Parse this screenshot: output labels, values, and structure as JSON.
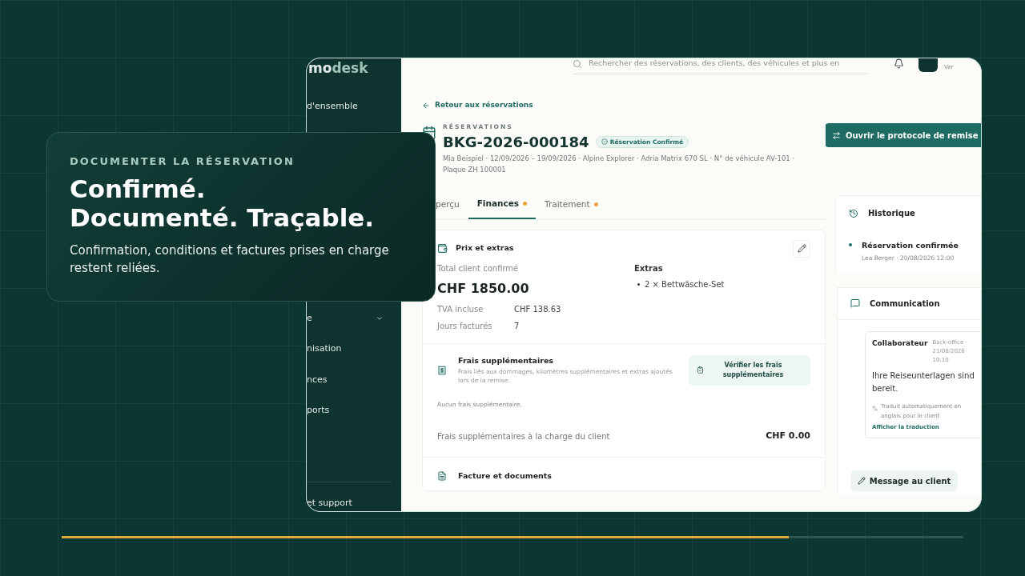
{
  "app": {
    "logo": {
      "part_1": "mo",
      "part_2": "desk"
    },
    "sidebar": {
      "items": [
        {
          "label": "d'ensemble",
          "kind": "link"
        },
        {
          "label": "e",
          "kind": "group"
        },
        {
          "label": "nisation",
          "kind": "link"
        },
        {
          "label": "nces",
          "kind": "link"
        },
        {
          "label": "ports",
          "kind": "link"
        }
      ],
      "footer": "et support"
    },
    "topbar": {
      "search_placeholder": "Rechercher des réservations, des clients, des véhicules et plus en",
      "user": "Ver"
    },
    "back_link": "Retour aux réservations",
    "header": {
      "eyebrow": "RÉSERVATIONS",
      "title": "BKG-2026-000184",
      "status": "Réservation Confirmé",
      "meta": "Mia Beispiel · 12/09/2026 – 19/09/2026 · Alpine Explorer · Adria Matrix 670 SL · N° de véhicule AV-101 · Plaque ZH 100001",
      "action": "Ouvrir le protocole de remise"
    },
    "tabs": [
      {
        "label": "perçu",
        "selected": false,
        "badge": false
      },
      {
        "label": "Finances",
        "selected": true,
        "badge": true
      },
      {
        "label": "Traitement",
        "selected": false,
        "badge": true
      }
    ],
    "price": {
      "title": "Prix et extras",
      "total_label": "Total client confirmé",
      "total": "CHF 1850.00",
      "rows": [
        {
          "label": "TVA incluse",
          "value": "CHF 138.63"
        },
        {
          "label": "Jours facturés",
          "value": "7"
        }
      ],
      "extras_title": "Extras",
      "extras": [
        "2 × Bettwäsche-Set"
      ]
    },
    "fees": {
      "title": "Frais supplémentaires",
      "description": "Frais liés aux dommages, kilomètres supplémentaires et extras ajoutés lors de la remise.",
      "button": "Vérifier les frais supplémentaires",
      "empty": "Aucun frais supplémentaire.",
      "total_label": "Frais supplémentaires à la charge du client",
      "total": "CHF 0.00"
    },
    "documents": {
      "title": "Facture et documents"
    },
    "history": {
      "title": "Historique",
      "entries": [
        {
          "title": "Réservation confirmée",
          "meta": "Lea Berger · 20/08/2026 12:00"
        }
      ]
    },
    "communication": {
      "title": "Communication",
      "messages": [
        {
          "author": "Collaborateur",
          "meta": "Back-office · 21/08/2026 10:10",
          "text": "Ihre Reiseunterlagen sind bereit.",
          "note": "Traduit automatiquement en anglais pour le client",
          "link": "Afficher la traduction"
        }
      ],
      "button": "Message au client"
    }
  },
  "overlay": {
    "eyebrow": "DOCUMENTER LA RÉSERVATION",
    "title_lines": [
      "Confirmé.",
      "Documenté. Traçable."
    ],
    "text": "Confirmation, conditions et factures prises en charge restent reliées."
  },
  "progress": {
    "level": 0.806
  }
}
